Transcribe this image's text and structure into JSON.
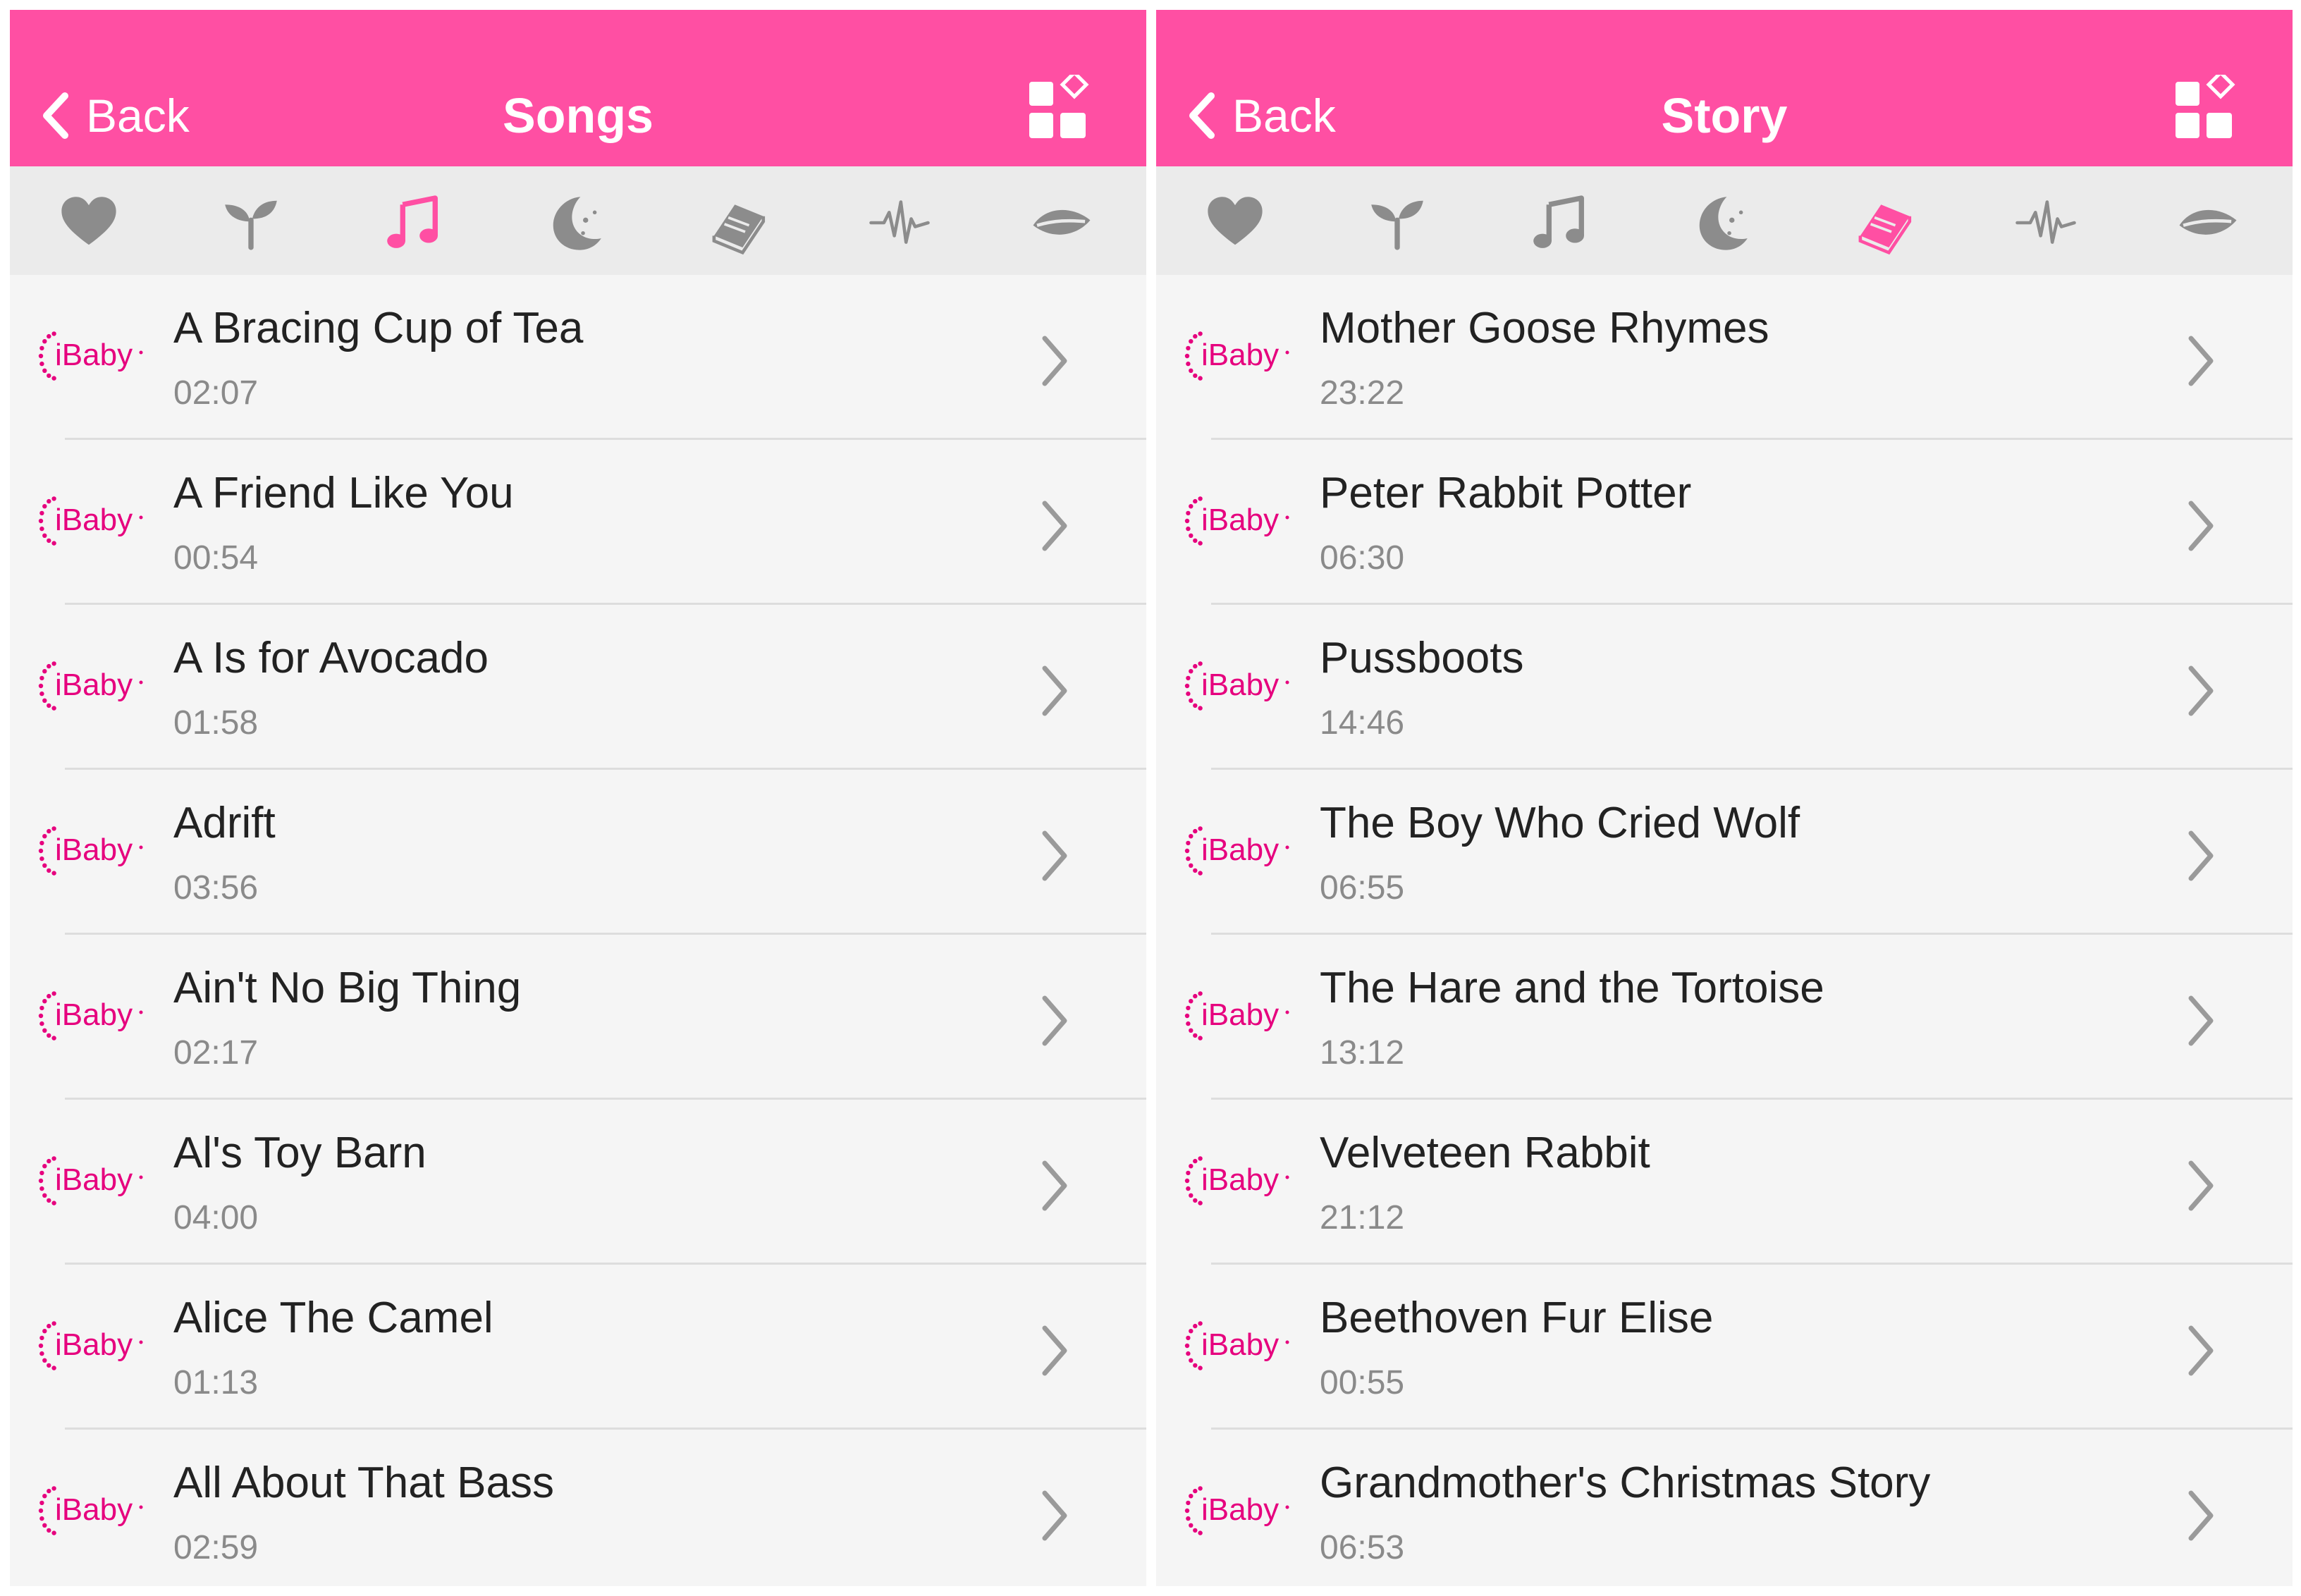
{
  "left": {
    "header": {
      "back_label": "Back",
      "title": "Songs"
    },
    "active_tab": 2,
    "items": [
      {
        "title": "A Bracing Cup of Tea",
        "duration": "02:07"
      },
      {
        "title": "A Friend Like You",
        "duration": "00:54"
      },
      {
        "title": "A Is for Avocado",
        "duration": "01:58"
      },
      {
        "title": "Adrift",
        "duration": "03:56"
      },
      {
        "title": "Ain't No Big Thing",
        "duration": "02:17"
      },
      {
        "title": "Al's Toy Barn",
        "duration": "04:00"
      },
      {
        "title": "Alice The Camel",
        "duration": "01:13"
      },
      {
        "title": "All About That Bass",
        "duration": "02:59"
      }
    ]
  },
  "right": {
    "header": {
      "back_label": "Back",
      "title": "Story"
    },
    "active_tab": 4,
    "items": [
      {
        "title": "Mother Goose Rhymes",
        "duration": "23:22"
      },
      {
        "title": "Peter Rabbit Potter",
        "duration": "06:30"
      },
      {
        "title": "Pussboots",
        "duration": "14:46"
      },
      {
        "title": "The Boy Who Cried Wolf",
        "duration": "06:55"
      },
      {
        "title": "The Hare and the Tortoise",
        "duration": "13:12"
      },
      {
        "title": "Velveteen Rabbit",
        "duration": "21:12"
      },
      {
        "title": "Beethoven Fur Elise",
        "duration": "00:55"
      },
      {
        "title": "Grandmother's Christmas Story",
        "duration": "06:53"
      }
    ]
  },
  "logo_text": "iBaby",
  "tab_icons": [
    "heart-icon",
    "sprout-icon",
    "music-note-icon",
    "moon-stars-icon",
    "book-icon",
    "heartbeat-icon",
    "leaf-icon"
  ],
  "colors": {
    "accent": "#ff4fa3",
    "inactive_icon": "#8c8c8c",
    "brand_text": "#e6007e"
  }
}
